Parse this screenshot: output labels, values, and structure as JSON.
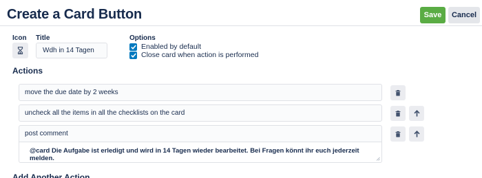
{
  "header": {
    "title": "Create a Card Button",
    "save_label": "Save",
    "cancel_label": "Cancel"
  },
  "form": {
    "icon_label": "Icon",
    "title_label": "Title",
    "title_value": "Wdh in 14 Tagen",
    "options_label": "Options",
    "options": [
      {
        "label": "Enabled by default",
        "checked": true
      },
      {
        "label": "Close card when action is performed",
        "checked": true
      }
    ],
    "icon": "hourglass-icon"
  },
  "actions": {
    "title": "Actions",
    "items": [
      {
        "text": "move the due date by 2 weeks"
      },
      {
        "text": "uncheck all the items in all the checklists on the card"
      },
      {
        "text": "post comment",
        "comment": "@card Die Aufgabe ist erledigt und wird in 14 Tagen wieder bearbeitet. Bei Fragen könnt ihr euch jederzeit melden."
      }
    ],
    "add_another_label": "Add Another Action"
  },
  "colors": {
    "save_button": "#5aac44",
    "checkbox": "#0079bf",
    "text": "#172b4d"
  }
}
